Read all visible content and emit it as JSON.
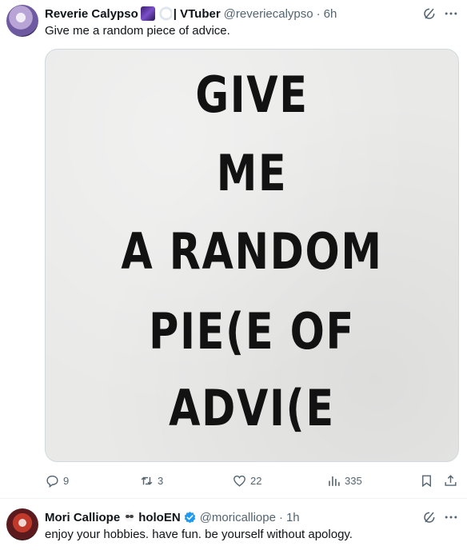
{
  "tweets": [
    {
      "name": "Reverie Calypso",
      "name_suffix": "| VTuber",
      "handle": "@reveriecalypso",
      "time": "6h",
      "text": "Give me a random piece of advice.",
      "media_lines": [
        "GIVE",
        "ME",
        "A RANDOM",
        "PIE(E OF",
        "ADVI(E"
      ],
      "stats": {
        "replies": "9",
        "reposts": "3",
        "likes": "22",
        "views": "335"
      }
    },
    {
      "name": "Mori Calliope",
      "name_suffix": "holoEN",
      "handle": "@moricalliope",
      "time": "1h",
      "text": "enjoy your hobbies. have fun. be yourself without apology."
    }
  ],
  "icons": {
    "verified_color": "#1d9bf0",
    "grok": "grok-icon",
    "more": "more-icon"
  }
}
